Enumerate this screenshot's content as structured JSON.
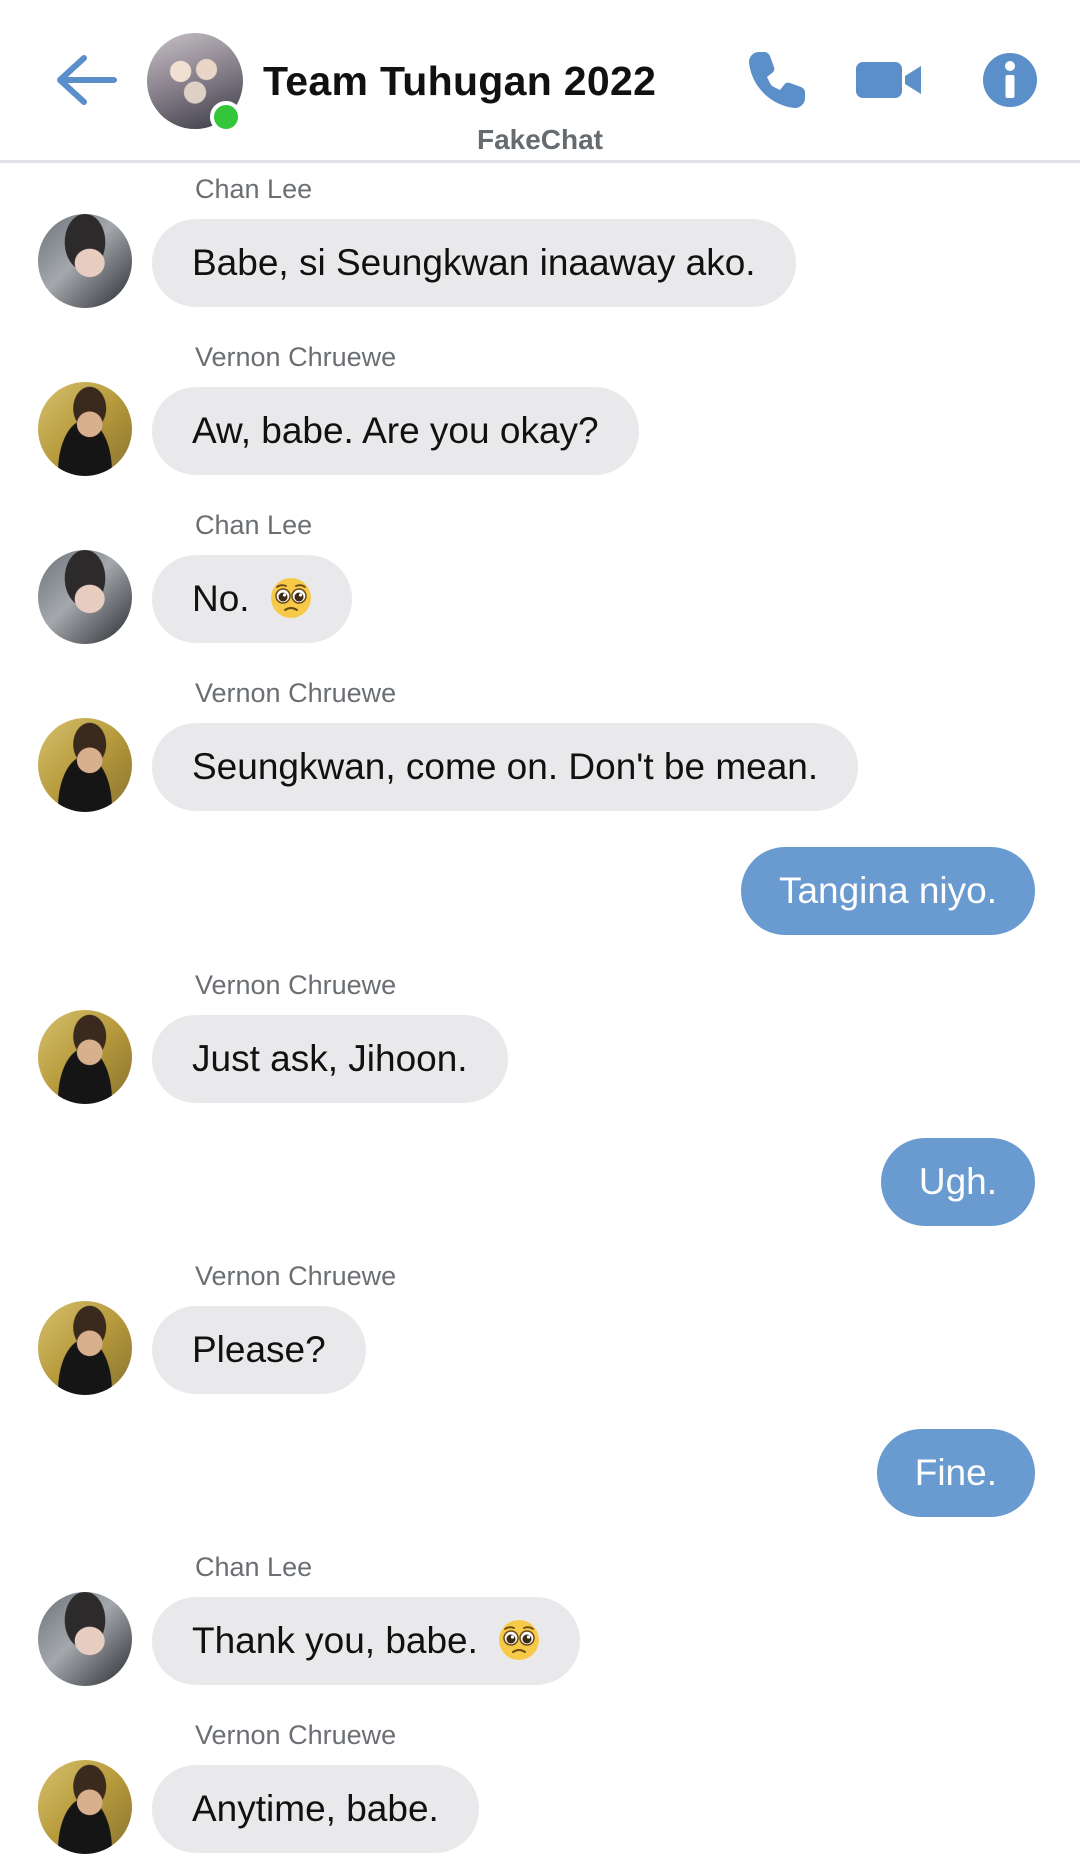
{
  "header": {
    "title": "Team Tuhugan 2022",
    "subtitle": "FakeChat",
    "accent_color": "#5b8fc9",
    "online_color": "#34c53a",
    "icons": [
      "back-arrow-icon",
      "phone-icon",
      "video-camera-icon",
      "info-icon"
    ]
  },
  "messages": [
    {
      "sender": "Chan Lee",
      "text": "Babe, si Seungkwan inaaway ako.",
      "direction": "incoming"
    },
    {
      "sender": "Vernon Chruewe",
      "text": "Aw, babe. Are you okay?",
      "direction": "incoming"
    },
    {
      "sender": "Chan Lee",
      "text": "No.",
      "emoji": "pleading-face",
      "direction": "incoming"
    },
    {
      "sender": "Vernon Chruewe",
      "text": "Seungkwan, come on. Don't be mean.",
      "direction": "incoming"
    },
    {
      "text": "Tangina niyo.",
      "direction": "outgoing"
    },
    {
      "sender": "Vernon Chruewe",
      "text": "Just ask, Jihoon.",
      "direction": "incoming"
    },
    {
      "text": "Ugh.",
      "direction": "outgoing"
    },
    {
      "sender": "Vernon Chruewe",
      "text": "Please?",
      "direction": "incoming"
    },
    {
      "text": "Fine.",
      "direction": "outgoing"
    },
    {
      "sender": "Chan Lee",
      "text": "Thank you, babe.",
      "emoji": "pleading-face",
      "direction": "incoming"
    },
    {
      "sender": "Vernon Chruewe",
      "text": "Anytime, babe.",
      "direction": "incoming"
    }
  ],
  "colors": {
    "incoming_bubble": "#e9e9eb",
    "outgoing_bubble": "#6a9bd0"
  }
}
